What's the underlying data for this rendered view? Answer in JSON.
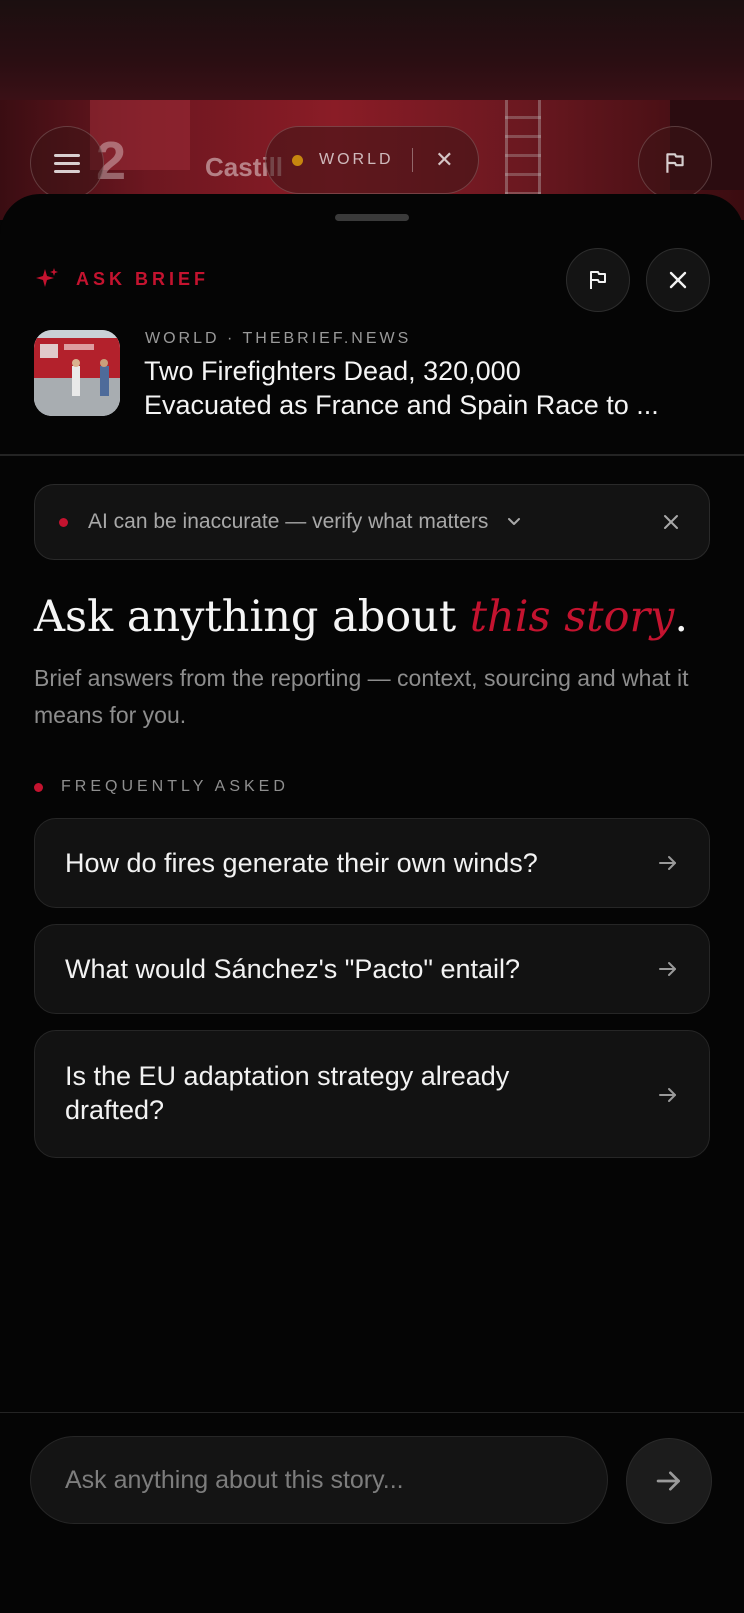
{
  "background": {
    "truck_text": "Castill",
    "truck_number": "2",
    "chip": {
      "label": "WORLD",
      "dot_color": "#c6860f"
    }
  },
  "sheet": {
    "brand_label": "ASK BRIEF",
    "accent_color": "#c4132f",
    "story": {
      "meta": "WORLD · THEBRIEF.NEWS",
      "headline_line1": "Two Firefighters Dead, 320,000",
      "headline_line2": "Evacuated as France and Spain Race to ..."
    },
    "notice": {
      "text": "AI can be inaccurate — verify what matters"
    },
    "hero": {
      "title_prefix": "Ask anything about ",
      "title_accent": "this story",
      "title_suffix": ".",
      "subtitle": "Brief answers from the reporting — context, sourcing and what it means for you."
    },
    "faq": {
      "label": "FREQUENTLY ASKED",
      "items": [
        {
          "question": "How do fires generate their own winds?"
        },
        {
          "question": "What would Sánchez's \"Pacto\" entail?"
        },
        {
          "question": "Is the EU adaptation strategy already drafted?"
        }
      ]
    },
    "composer": {
      "placeholder": "Ask anything about this story..."
    }
  }
}
